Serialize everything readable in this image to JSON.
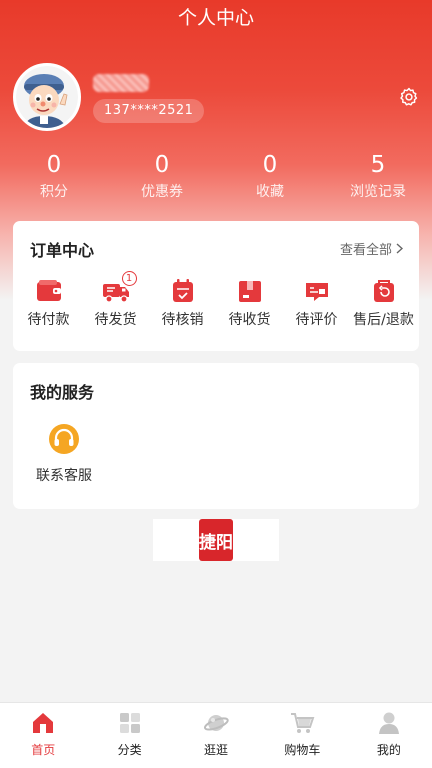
{
  "header": {
    "title": "个人中心"
  },
  "profile": {
    "phone": "137****2521"
  },
  "stats": [
    {
      "value": "0",
      "label": "积分"
    },
    {
      "value": "0",
      "label": "优惠券"
    },
    {
      "value": "0",
      "label": "收藏"
    },
    {
      "value": "5",
      "label": "浏览记录"
    }
  ],
  "orders": {
    "title": "订单中心",
    "view_all": "查看全部",
    "items": [
      {
        "label": "待付款",
        "icon": "wallet-icon"
      },
      {
        "label": "待发货",
        "icon": "delivery-truck-icon",
        "badge": "1"
      },
      {
        "label": "待核销",
        "icon": "calendar-check-icon"
      },
      {
        "label": "待收货",
        "icon": "package-box-icon"
      },
      {
        "label": "待评价",
        "icon": "review-card-icon"
      },
      {
        "label": "售后/退款",
        "icon": "refund-bag-icon"
      }
    ]
  },
  "services": {
    "title": "我的服务",
    "items": [
      {
        "label": "联系客服",
        "icon": "headset-icon"
      }
    ]
  },
  "brand": {
    "logo_text": "捷阳"
  },
  "tabbar": {
    "items": [
      {
        "label": "首页",
        "icon": "home-icon"
      },
      {
        "label": "分类",
        "icon": "category-grid-icon"
      },
      {
        "label": "逛逛",
        "icon": "planet-icon"
      },
      {
        "label": "购物车",
        "icon": "cart-icon"
      },
      {
        "label": "我的",
        "icon": "user-icon"
      }
    ],
    "active": "我的"
  },
  "colors": {
    "accent": "#e4393c",
    "header_red": "#e83a2a",
    "icon_gold": "#f5a623"
  }
}
